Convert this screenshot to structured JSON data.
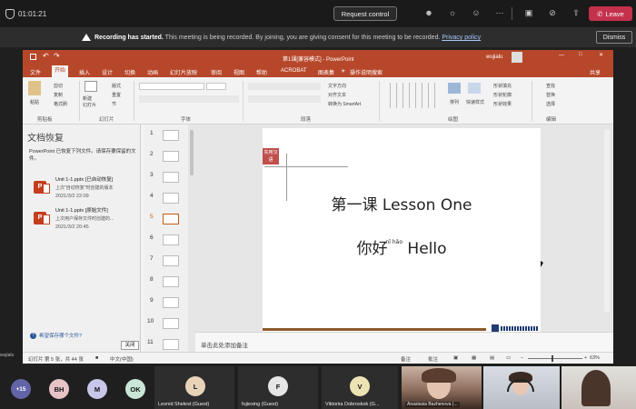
{
  "teams": {
    "timer": "01:01:21",
    "request_control": "Request control",
    "leave": "Leave",
    "icons": [
      "people-icon",
      "chat-icon",
      "reactions-icon",
      "more-icon",
      "camera-icon",
      "mic-off-icon",
      "share-icon"
    ]
  },
  "banner": {
    "title": "Recording has started.",
    "text": " This meeting is being recorded. By joining, you are giving consent for this meeting to be recorded. ",
    "link": "Privacy policy",
    "dismiss": "Dismiss"
  },
  "ppt": {
    "window_title": "第1课[兼容模式] - PowerPoint",
    "user": "wujialu",
    "share": "共享",
    "tabs": [
      "文件",
      "开始",
      "插入",
      "设计",
      "切换",
      "动画",
      "幻灯片放映",
      "审阅",
      "视图",
      "帮助",
      "ACROBAT",
      "图表集",
      "操作说明搜索"
    ],
    "active_tab": "开始",
    "ribbon": {
      "paste": "粘贴",
      "new_slide": "新建\n幻灯片",
      "groups": [
        "剪贴板",
        "幻灯片",
        "字体",
        "段落",
        "绘图",
        "编辑"
      ],
      "layout": "版式",
      "reset": "重置",
      "section": "节",
      "find": "查找",
      "replace": "替换",
      "select": "选择",
      "arrange": "排列",
      "quick_styles": "快速样式",
      "text_direction": "文字方向",
      "align_text": "对齐文本",
      "smartart": "转换为 SmartArt",
      "shape_fill": "形状填充",
      "shape_outline": "形状轮廓",
      "shape_effects": "形状效果",
      "cut": "剪切",
      "copy": "复制",
      "format_painter": "格式刷"
    },
    "recovery": {
      "title": "文档恢复",
      "desc": "PowerPoint 已恢复下列文件。请保存要保留的文件。",
      "files": [
        {
          "name": "Unit 1-1.pptx [已自动恢复]",
          "sub": "上次\"自动恢复\"时创建的版本",
          "date": "2021/3/2 22:09"
        },
        {
          "name": "Unit 1-1.pptx [原始文件]",
          "sub": "上次用户保存文件时创建的...",
          "date": "2021/3/2 20:45"
        }
      ],
      "help": "希望保存哪个文件?",
      "close": "关闭"
    },
    "thumbnails": [
      "1",
      "2",
      "3",
      "4",
      "5",
      "6",
      "7",
      "8",
      "9",
      "10",
      "11"
    ],
    "selected_slide": "5",
    "slide": {
      "badge": "实用汉语",
      "line1": "第一课 Lesson One",
      "line2_cn": "你好",
      "pinyin": "nǐ hǎo",
      "line2_en": "Hello"
    },
    "notes_placeholder": "单击此处添加备注",
    "status": {
      "slide_info": "幻灯片 第 5 张，共 44 张",
      "language": "中文(中国)",
      "notes": "备注",
      "comments": "批注",
      "zoom": "63%"
    }
  },
  "left_tag": "wujialu",
  "participants": {
    "overflow": "+15",
    "avatars": [
      {
        "initials": "BH",
        "color": "#e7c3c8"
      },
      {
        "initials": "M",
        "color": "#c8c6e8"
      },
      {
        "initials": "OK",
        "color": "#c9e6d6"
      }
    ],
    "tiles": [
      {
        "initial": "L",
        "name": "Leonid Shelest (Guest)",
        "color": "#e8d2b8"
      },
      {
        "initial": "F",
        "name": "fujiexing (Guest)",
        "color": "#e6e6e6"
      },
      {
        "initial": "V",
        "name": "Viktoriia Dobroskok (G...",
        "color": "#ece3b5"
      }
    ],
    "videos": [
      "Anastasia Bazhenova (...",
      "",
      ""
    ]
  }
}
